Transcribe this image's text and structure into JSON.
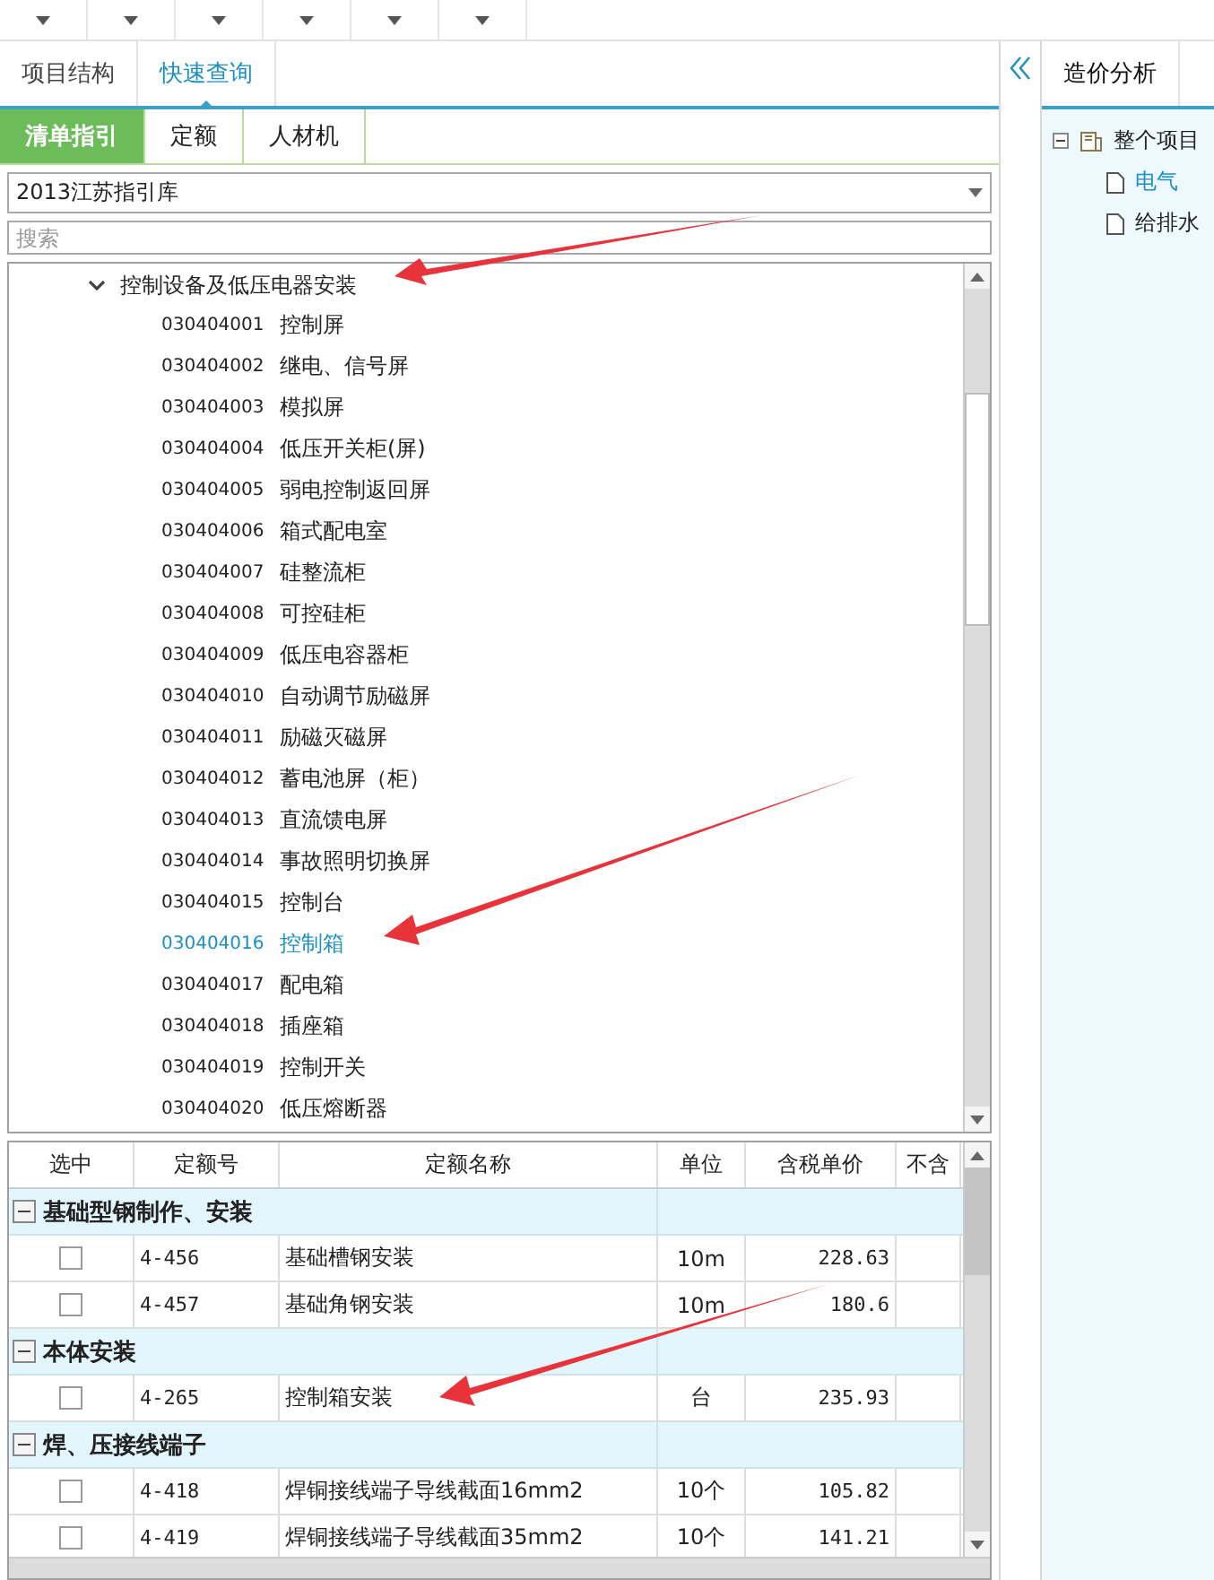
{
  "left_tabs": [
    {
      "label": "项目结构",
      "selected": false
    },
    {
      "label": "快速查询",
      "selected": true
    }
  ],
  "sub_tabs": [
    {
      "label": "清单指引",
      "selected": true
    },
    {
      "label": "定额",
      "selected": false
    },
    {
      "label": "人材机",
      "selected": false
    }
  ],
  "library_select": {
    "value": "2013江苏指引库"
  },
  "search": {
    "placeholder": "搜索"
  },
  "tree": {
    "label": "控制设备及低压电器安装",
    "expanded": true,
    "children": [
      {
        "code": "030404001",
        "name": "控制屏",
        "selected": false
      },
      {
        "code": "030404002",
        "name": "继电、信号屏",
        "selected": false
      },
      {
        "code": "030404003",
        "name": "模拟屏",
        "selected": false
      },
      {
        "code": "030404004",
        "name": "低压开关柜(屏)",
        "selected": false
      },
      {
        "code": "030404005",
        "name": "弱电控制返回屏",
        "selected": false
      },
      {
        "code": "030404006",
        "name": "箱式配电室",
        "selected": false
      },
      {
        "code": "030404007",
        "name": "硅整流柜",
        "selected": false
      },
      {
        "code": "030404008",
        "name": "可控硅柜",
        "selected": false
      },
      {
        "code": "030404009",
        "name": "低压电容器柜",
        "selected": false
      },
      {
        "code": "030404010",
        "name": "自动调节励磁屏",
        "selected": false
      },
      {
        "code": "030404011",
        "name": "励磁灭磁屏",
        "selected": false
      },
      {
        "code": "030404012",
        "name": "蓄电池屏（柜）",
        "selected": false
      },
      {
        "code": "030404013",
        "name": "直流馈电屏",
        "selected": false
      },
      {
        "code": "030404014",
        "name": "事故照明切换屏",
        "selected": false
      },
      {
        "code": "030404015",
        "name": "控制台",
        "selected": false
      },
      {
        "code": "030404016",
        "name": "控制箱",
        "selected": true
      },
      {
        "code": "030404017",
        "name": "配电箱",
        "selected": false
      },
      {
        "code": "030404018",
        "name": "插座箱",
        "selected": false
      },
      {
        "code": "030404019",
        "name": "控制开关",
        "selected": false
      },
      {
        "code": "030404020",
        "name": "低压熔断器",
        "selected": false
      }
    ]
  },
  "table": {
    "columns": [
      "选中",
      "定额号",
      "定额名称",
      "单位",
      "含税单价",
      "不含"
    ],
    "rows": [
      {
        "kind": "group",
        "label": "基础型钢制作、安装",
        "expanded": true
      },
      {
        "kind": "item",
        "checked": false,
        "code": "4-456",
        "name": "基础槽钢安装",
        "unit": "10m",
        "price": "228.63"
      },
      {
        "kind": "item",
        "checked": false,
        "code": "4-457",
        "name": "基础角钢安装",
        "unit": "10m",
        "price": "180.6"
      },
      {
        "kind": "group",
        "label": "本体安装",
        "expanded": true
      },
      {
        "kind": "item",
        "checked": false,
        "code": "4-265",
        "name": "控制箱安装",
        "unit": "台",
        "price": "235.93"
      },
      {
        "kind": "group",
        "label": "焊、压接线端子",
        "expanded": true
      },
      {
        "kind": "item",
        "checked": false,
        "code": "4-418",
        "name": "焊铜接线端子导线截面16mm2",
        "unit": "10个",
        "price": "105.82"
      },
      {
        "kind": "item",
        "checked": false,
        "code": "4-419",
        "name": "焊铜接线端子导线截面35mm2",
        "unit": "10个",
        "price": "141.21"
      }
    ]
  },
  "right_tabs": [
    {
      "label": "造价分析",
      "selected": true
    }
  ],
  "project_tree": {
    "label": "整个项目",
    "expanded": true,
    "children": [
      {
        "label": "电气",
        "selected": true
      },
      {
        "label": "给排水",
        "selected": false
      }
    ]
  }
}
